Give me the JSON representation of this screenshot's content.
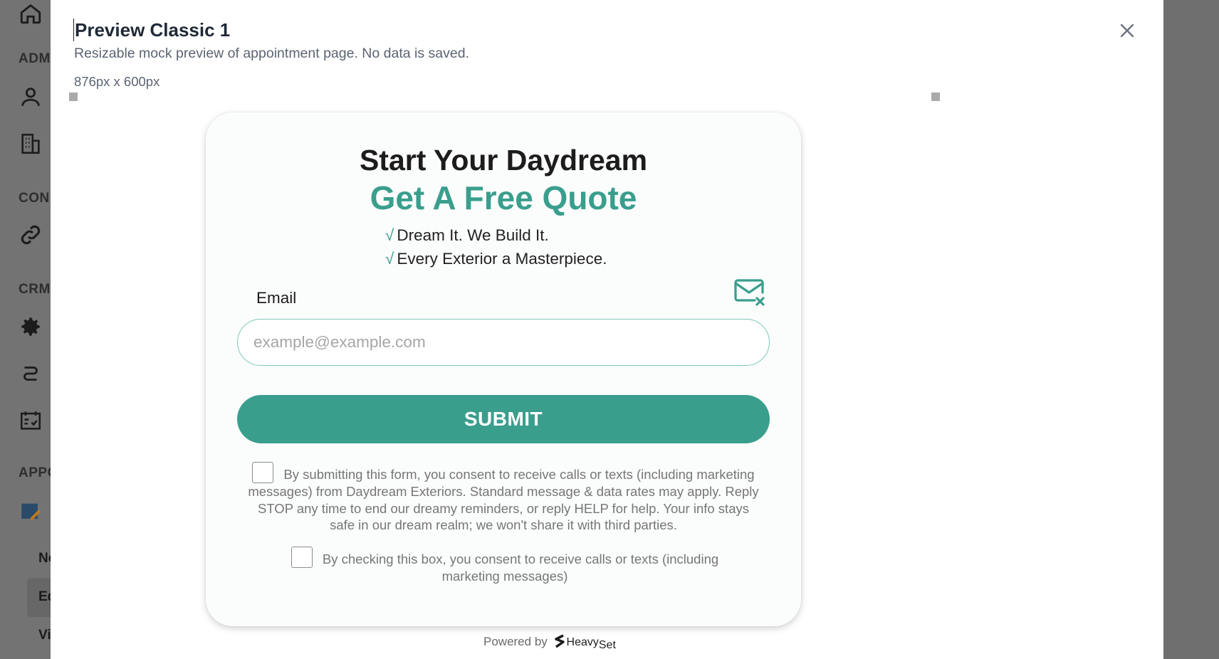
{
  "background_sidebar": {
    "sections": [
      "ADM",
      "CON",
      "CRM",
      "APPO"
    ],
    "items": [
      "Ne",
      "Ed",
      "Vi"
    ],
    "icons": [
      "home-icon",
      "users-icon",
      "building-icon",
      "link-icon",
      "gear-icon",
      "flow-icon",
      "calendar-icon",
      "edit-icon"
    ]
  },
  "modal": {
    "title": "Preview Classic 1",
    "subtitle": "Resizable mock preview of appointment page. No data is saved.",
    "size_label": "876px x 600px"
  },
  "form": {
    "heading": "Start Your Daydream",
    "subheading": "Get A Free Quote",
    "checks": [
      "Dream It. We Build It.",
      "Every Exterior a Masterpiece."
    ],
    "check_mark": "√",
    "email_label": "Email",
    "email_placeholder": "example@example.com",
    "submit_label": "SUBMIT",
    "consent_1": "By submitting this form, you consent to receive calls or texts (including marketing messages) from Daydream Exteriors. Standard message & data rates may apply. Reply STOP any time to end our dreamy reminders, or reply HELP for help. Your info stays safe in our dream realm; we won't share it with third parties.",
    "consent_2": "By checking this box, you consent to receive calls or texts (including marketing messages)"
  },
  "footer": {
    "powered_by": "Powered by",
    "brand_a": "Heavy",
    "brand_b": "Set"
  },
  "colors": {
    "accent": "#3a9e8d",
    "input_border": "#7fc9bb"
  }
}
